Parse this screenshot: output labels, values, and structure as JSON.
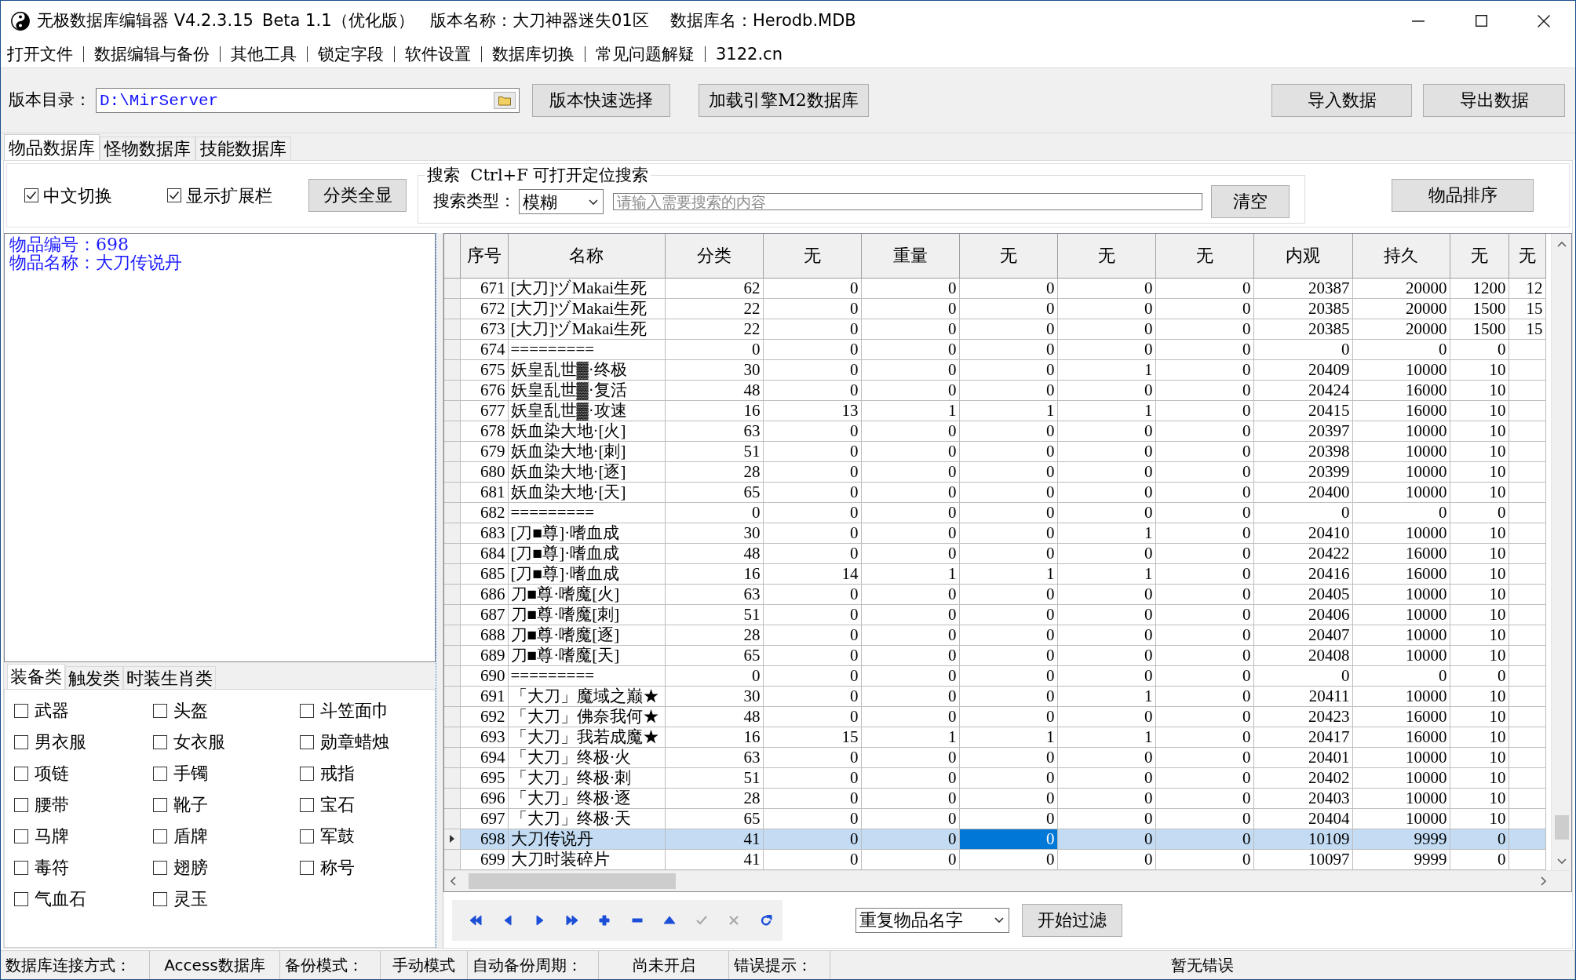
{
  "window": {
    "title": "无极数据库编辑器 V4.2.3.15",
    "edition": "Beta 1.1（优化版）",
    "version_name": "版本名称：大刀神器迷失01区",
    "database_name": "数据库名：Herodb.MDB"
  },
  "menu": [
    "打开文件",
    "数据编辑与备份",
    "其他工具",
    "锁定字段",
    "软件设置",
    "数据库切换",
    "常见问题解疑",
    "3122.cn"
  ],
  "toolbar": {
    "directory_label": "版本目录：",
    "directory_value": "D:\\MirServer",
    "buttons_left": [
      "版本快速选择",
      "加载引擎M2数据库"
    ],
    "buttons_right": [
      "导入数据",
      "导出数据"
    ]
  },
  "tabs": [
    {
      "label": "物品数据库",
      "selected": true
    },
    {
      "label": "怪物数据库",
      "selected": false
    },
    {
      "label": "技能数据库",
      "selected": false
    }
  ],
  "filter_panel": {
    "options": [
      {
        "label": "中文切换",
        "checked": true
      },
      {
        "label": "显示扩展栏",
        "checked": true
      }
    ],
    "show_all_button": "分类全显",
    "search": {
      "caption": "搜索  Ctrl+F 可打开定位搜索",
      "type_label": "搜索类型：",
      "type": "模糊",
      "placeholder": "请输入需要搜索的内容",
      "clear_button": "清空"
    },
    "sort_button": "物品排序"
  },
  "details": {
    "lines": [
      "物品编号：698",
      "物品名称：大刀传说丹"
    ]
  },
  "category_tabs": [
    {
      "label": "装备类",
      "selected": true
    },
    {
      "label": "触发类",
      "selected": false
    },
    {
      "label": "时装生肖类",
      "selected": false
    }
  ],
  "categories": [
    {
      "label": "武器",
      "checked": false
    },
    {
      "label": "头盔",
      "checked": false
    },
    {
      "label": "斗笠面巾",
      "checked": false
    },
    {
      "label": "男衣服",
      "checked": false
    },
    {
      "label": "女衣服",
      "checked": false
    },
    {
      "label": "勋章蜡烛",
      "checked": false
    },
    {
      "label": "项链",
      "checked": false
    },
    {
      "label": "手镯",
      "checked": false
    },
    {
      "label": "戒指",
      "checked": false
    },
    {
      "label": "腰带",
      "checked": false
    },
    {
      "label": "靴子",
      "checked": false
    },
    {
      "label": "宝石",
      "checked": false
    },
    {
      "label": "马牌",
      "checked": false
    },
    {
      "label": "盾牌",
      "checked": false
    },
    {
      "label": "军鼓",
      "checked": false
    },
    {
      "label": "毒符",
      "checked": false
    },
    {
      "label": "翅膀",
      "checked": false
    },
    {
      "label": "称号",
      "checked": false
    },
    {
      "label": "气血石",
      "checked": false
    },
    {
      "label": "灵玉",
      "checked": false
    }
  ],
  "grid": {
    "columns": [
      {
        "label": "序号",
        "current": false
      },
      {
        "label": "名称",
        "current": false
      },
      {
        "label": "分类",
        "current": false
      },
      {
        "label": "无",
        "current": false
      },
      {
        "label": "重量",
        "current": false
      },
      {
        "label": "无",
        "current": true
      },
      {
        "label": "无",
        "current": false
      },
      {
        "label": "无",
        "current": false
      },
      {
        "label": "内观",
        "current": false
      },
      {
        "label": "持久",
        "current": false
      },
      {
        "label": "无",
        "current": false
      },
      {
        "label": "无",
        "current": false
      }
    ],
    "rows": [
      {
        "cells": [
          "671",
          "[大刀]ヅMakai生死",
          "62",
          "0",
          "0",
          "0",
          "0",
          "0",
          "20387",
          "20000",
          "1200",
          "12"
        ],
        "selected": false
      },
      {
        "cells": [
          "672",
          "[大刀]ヅMakai生死",
          "22",
          "0",
          "0",
          "0",
          "0",
          "0",
          "20385",
          "20000",
          "1500",
          "15"
        ],
        "selected": false
      },
      {
        "cells": [
          "673",
          "[大刀]ヅMakai生死",
          "22",
          "0",
          "0",
          "0",
          "0",
          "0",
          "20385",
          "20000",
          "1500",
          "15"
        ],
        "selected": false
      },
      {
        "cells": [
          "674",
          "=========",
          "0",
          "0",
          "0",
          "0",
          "0",
          "0",
          "0",
          "0",
          "0"
        ],
        "selected": false
      },
      {
        "cells": [
          "675",
          "妖皇乱世▓·终极",
          "30",
          "0",
          "0",
          "0",
          "1",
          "0",
          "20409",
          "10000",
          "10"
        ],
        "selected": false
      },
      {
        "cells": [
          "676",
          "妖皇乱世▓·复活",
          "48",
          "0",
          "0",
          "0",
          "0",
          "0",
          "20424",
          "16000",
          "10"
        ],
        "selected": false
      },
      {
        "cells": [
          "677",
          "妖皇乱世▓·攻速",
          "16",
          "13",
          "1",
          "1",
          "1",
          "0",
          "20415",
          "16000",
          "10"
        ],
        "selected": false
      },
      {
        "cells": [
          "678",
          "妖血染大地·[火]",
          "63",
          "0",
          "0",
          "0",
          "0",
          "0",
          "20397",
          "10000",
          "10"
        ],
        "selected": false
      },
      {
        "cells": [
          "679",
          "妖血染大地·[刺]",
          "51",
          "0",
          "0",
          "0",
          "0",
          "0",
          "20398",
          "10000",
          "10"
        ],
        "selected": false
      },
      {
        "cells": [
          "680",
          "妖血染大地·[逐]",
          "28",
          "0",
          "0",
          "0",
          "0",
          "0",
          "20399",
          "10000",
          "10"
        ],
        "selected": false
      },
      {
        "cells": [
          "681",
          "妖血染大地·[天]",
          "65",
          "0",
          "0",
          "0",
          "0",
          "0",
          "20400",
          "10000",
          "10"
        ],
        "selected": false
      },
      {
        "cells": [
          "682",
          "=========",
          "0",
          "0",
          "0",
          "0",
          "0",
          "0",
          "0",
          "0",
          "0"
        ],
        "selected": false
      },
      {
        "cells": [
          "683",
          "[刀■尊]·嗜血成",
          "30",
          "0",
          "0",
          "0",
          "1",
          "0",
          "20410",
          "10000",
          "10"
        ],
        "selected": false
      },
      {
        "cells": [
          "684",
          "[刀■尊]·嗜血成",
          "48",
          "0",
          "0",
          "0",
          "0",
          "0",
          "20422",
          "16000",
          "10"
        ],
        "selected": false
      },
      {
        "cells": [
          "685",
          "[刀■尊]·嗜血成",
          "16",
          "14",
          "1",
          "1",
          "1",
          "0",
          "20416",
          "16000",
          "10"
        ],
        "selected": false
      },
      {
        "cells": [
          "686",
          "刀■尊·嗜魔[火]",
          "63",
          "0",
          "0",
          "0",
          "0",
          "0",
          "20405",
          "10000",
          "10"
        ],
        "selected": false
      },
      {
        "cells": [
          "687",
          "刀■尊·嗜魔[刺]",
          "51",
          "0",
          "0",
          "0",
          "0",
          "0",
          "20406",
          "10000",
          "10"
        ],
        "selected": false
      },
      {
        "cells": [
          "688",
          "刀■尊·嗜魔[逐]",
          "28",
          "0",
          "0",
          "0",
          "0",
          "0",
          "20407",
          "10000",
          "10"
        ],
        "selected": false
      },
      {
        "cells": [
          "689",
          "刀■尊·嗜魔[天]",
          "65",
          "0",
          "0",
          "0",
          "0",
          "0",
          "20408",
          "10000",
          "10"
        ],
        "selected": false
      },
      {
        "cells": [
          "690",
          "=========",
          "0",
          "0",
          "0",
          "0",
          "0",
          "0",
          "0",
          "0",
          "0"
        ],
        "selected": false
      },
      {
        "cells": [
          "691",
          "「大刀」魔域之巅★",
          "30",
          "0",
          "0",
          "0",
          "1",
          "0",
          "20411",
          "10000",
          "10"
        ],
        "selected": false
      },
      {
        "cells": [
          "692",
          "「大刀」佛奈我何★",
          "48",
          "0",
          "0",
          "0",
          "0",
          "0",
          "20423",
          "16000",
          "10"
        ],
        "selected": false
      },
      {
        "cells": [
          "693",
          "「大刀」我若成魔★",
          "16",
          "15",
          "1",
          "1",
          "1",
          "0",
          "20417",
          "16000",
          "10"
        ],
        "selected": false
      },
      {
        "cells": [
          "694",
          "「大刀」终极·火",
          "63",
          "0",
          "0",
          "0",
          "0",
          "0",
          "20401",
          "10000",
          "10"
        ],
        "selected": false
      },
      {
        "cells": [
          "695",
          "「大刀」终极·刺",
          "51",
          "0",
          "0",
          "0",
          "0",
          "0",
          "20402",
          "10000",
          "10"
        ],
        "selected": false
      },
      {
        "cells": [
          "696",
          "「大刀」终极·逐",
          "28",
          "0",
          "0",
          "0",
          "0",
          "0",
          "20403",
          "10000",
          "10"
        ],
        "selected": false
      },
      {
        "cells": [
          "697",
          "「大刀」终极·天",
          "65",
          "0",
          "0",
          "0",
          "0",
          "0",
          "20404",
          "10000",
          "10"
        ],
        "selected": false
      },
      {
        "cells": [
          "698",
          "大刀传说丹",
          "41",
          "0",
          "0",
          "0",
          "0",
          "0",
          "10109",
          "9999",
          "0"
        ],
        "selected": true
      },
      {
        "cells": [
          "699",
          "大刀时装碎片",
          "41",
          "0",
          "0",
          "0",
          "0",
          "0",
          "10097",
          "9999",
          "0"
        ],
        "selected": false
      }
    ]
  },
  "navigator": [
    {
      "kind": "first",
      "disabled": false
    },
    {
      "kind": "prior",
      "disabled": false
    },
    {
      "kind": "next",
      "disabled": false
    },
    {
      "kind": "last",
      "disabled": false
    },
    {
      "kind": "insert",
      "disabled": false
    },
    {
      "kind": "delete",
      "disabled": false
    },
    {
      "kind": "edit",
      "disabled": false
    },
    {
      "kind": "post",
      "disabled": true
    },
    {
      "kind": "cancel",
      "disabled": true
    },
    {
      "kind": "refresh",
      "disabled": false
    }
  ],
  "record_filter": {
    "mode": "重复物品名字",
    "start_button": "开始过滤"
  },
  "status_bar": [
    {
      "kind": "label",
      "text": "数据库连接方式："
    },
    {
      "kind": "value",
      "text": "Access数据库"
    },
    {
      "kind": "label",
      "text": "备份模式："
    },
    {
      "kind": "value",
      "text": "手动模式"
    },
    {
      "kind": "label",
      "text": "自动备份周期："
    },
    {
      "kind": "value",
      "text": "尚未开启"
    },
    {
      "kind": "label",
      "text": "错误提示："
    },
    {
      "kind": "value",
      "text": "暂无错误"
    }
  ]
}
